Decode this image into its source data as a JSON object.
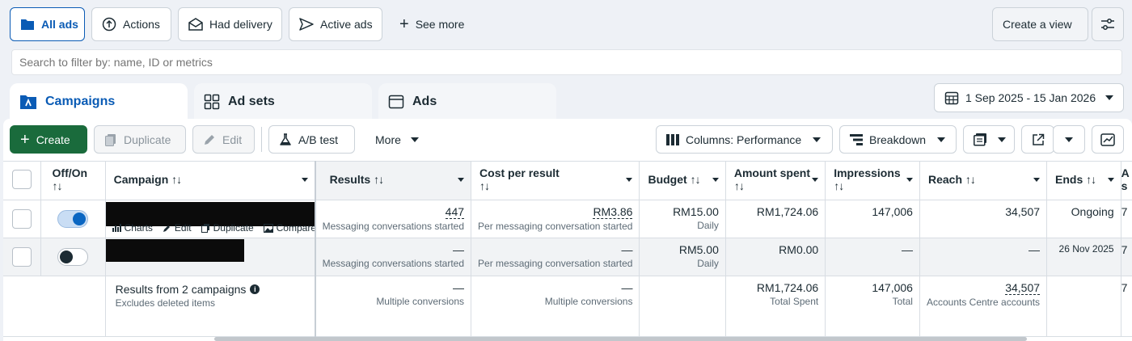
{
  "filter_bar": {
    "all_ads": "All ads",
    "actions": "Actions",
    "had_delivery": "Had delivery",
    "active_ads": "Active ads",
    "see_more": "See more",
    "create_view": "Create a view"
  },
  "search": {
    "placeholder": "Search to filter by: name, ID or metrics"
  },
  "tabs": {
    "campaigns": "Campaigns",
    "ad_sets": "Ad sets",
    "ads": "Ads"
  },
  "date_range": "1 Sep 2025 - 15 Jan 2026",
  "toolbar": {
    "create": "Create",
    "duplicate": "Duplicate",
    "edit": "Edit",
    "ab_test": "A/B test",
    "more": "More",
    "columns": "Columns: Performance",
    "breakdown": "Breakdown"
  },
  "columns": {
    "off_on": "Off/On",
    "campaign": "Campaign",
    "results": "Results",
    "cost_per_result": "Cost per result",
    "budget": "Budget",
    "amount_spent": "Amount spent",
    "impressions": "Impressions",
    "reach": "Reach",
    "ends": "Ends",
    "last_partial": "A",
    "last_partial2": "s"
  },
  "rows": [
    {
      "toggle": "on",
      "actions": {
        "charts": "Charts",
        "edit": "Edit",
        "duplicate": "Duplicate",
        "compare": "Compare",
        "more": "···"
      },
      "results": "447",
      "results_sub": "Messaging conversations started",
      "cost": "RM3.86",
      "cost_sub": "Per messaging conversation started",
      "budget": "RM15.00",
      "budget_sub": "Daily",
      "spent": "RM1,724.06",
      "impressions": "147,006",
      "reach": "34,507",
      "ends": "Ongoing",
      "last": "7"
    },
    {
      "toggle": "off",
      "results": "—",
      "results_sub": "Messaging conversations started",
      "cost": "—",
      "cost_sub": "Per messaging conversation started",
      "budget": "RM5.00",
      "budget_sub": "Daily",
      "spent": "RM0.00",
      "impressions": "—",
      "reach": "—",
      "ends": "26 Nov 2025",
      "last": "7"
    }
  ],
  "summary": {
    "title": "Results from 2 campaigns",
    "subtitle": "Excludes deleted items",
    "results": "—",
    "results_sub": "Multiple conversions",
    "cost": "—",
    "cost_sub": "Multiple conversions",
    "spent": "RM1,724.06",
    "spent_sub": "Total Spent",
    "impressions": "147,006",
    "impressions_sub": "Total",
    "reach": "34,507",
    "reach_sub": "Accounts Centre accounts",
    "last": "7"
  },
  "colors": {
    "accent": "#0a5bb5",
    "create_green": "#1a6b3c"
  }
}
